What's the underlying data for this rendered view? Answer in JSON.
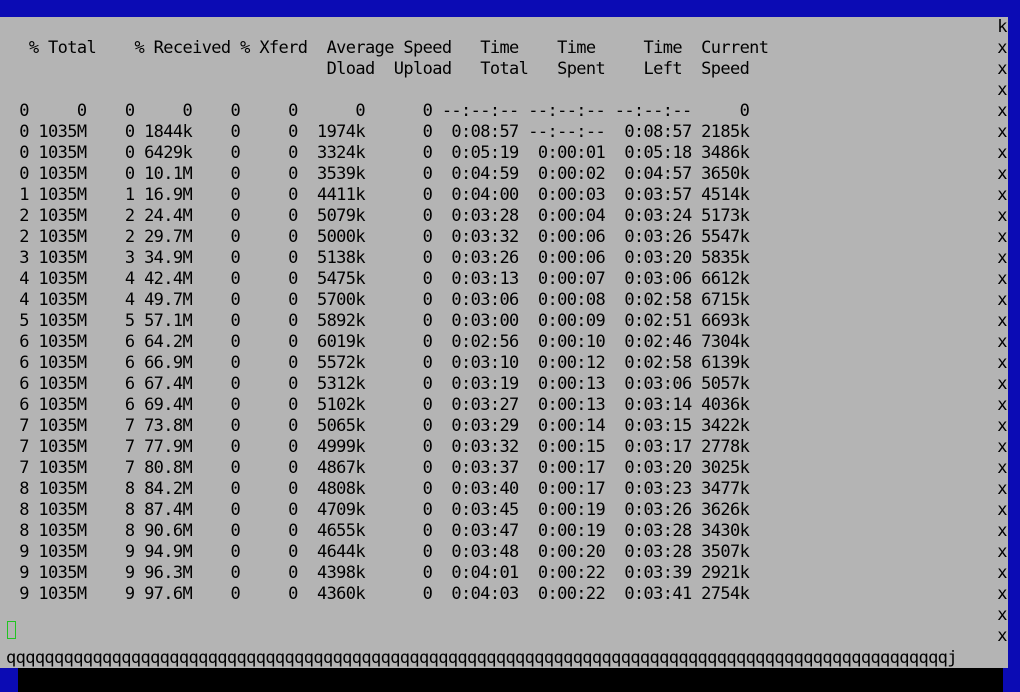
{
  "terminal": {
    "header_lines": [
      "   % Total    % Received % Xferd  Average Speed   Time    Time     Time  Current",
      "                                  Dload  Upload   Total   Spent    Left  Speed"
    ],
    "progress_lines": [
      "  0     0    0     0    0     0      0      0 --:--:-- --:--:-- --:--:--     0",
      "  0 1035M    0 1844k    0     0  1974k      0  0:08:57 --:--:--  0:08:57 2185k",
      "  0 1035M    0 6429k    0     0  3324k      0  0:05:19  0:00:01  0:05:18 3486k",
      "  0 1035M    0 10.1M    0     0  3539k      0  0:04:59  0:00:02  0:04:57 3650k",
      "  1 1035M    1 16.9M    0     0  4411k      0  0:04:00  0:00:03  0:03:57 4514k",
      "  2 1035M    2 24.4M    0     0  5079k      0  0:03:28  0:00:04  0:03:24 5173k",
      "  2 1035M    2 29.7M    0     0  5000k      0  0:03:32  0:00:06  0:03:26 5547k",
      "  3 1035M    3 34.9M    0     0  5138k      0  0:03:26  0:00:06  0:03:20 5835k",
      "  4 1035M    4 42.4M    0     0  5475k      0  0:03:13  0:00:07  0:03:06 6612k",
      "  4 1035M    4 49.7M    0     0  5700k      0  0:03:06  0:00:08  0:02:58 6715k",
      "  5 1035M    5 57.1M    0     0  5892k      0  0:03:00  0:00:09  0:02:51 6693k",
      "  6 1035M    6 64.2M    0     0  6019k      0  0:02:56  0:00:10  0:02:46 7304k",
      "  6 1035M    6 66.9M    0     0  5572k      0  0:03:10  0:00:12  0:02:58 6139k",
      "  6 1035M    6 67.4M    0     0  5312k      0  0:03:19  0:00:13  0:03:06 5057k",
      "  6 1035M    6 69.4M    0     0  5102k      0  0:03:27  0:00:13  0:03:14 4036k",
      "  7 1035M    7 73.8M    0     0  5065k      0  0:03:29  0:00:14  0:03:15 3422k",
      "  7 1035M    7 77.9M    0     0  4999k      0  0:03:32  0:00:15  0:03:17 2778k",
      "  7 1035M    7 80.8M    0     0  4867k      0  0:03:37  0:00:17  0:03:20 3025k",
      "  8 1035M    8 84.2M    0     0  4808k      0  0:03:40  0:00:17  0:03:23 3477k",
      "  8 1035M    8 87.4M    0     0  4709k      0  0:03:45  0:00:19  0:03:26 3626k",
      "  8 1035M    8 90.6M    0     0  4655k      0  0:03:47  0:00:19  0:03:28 3430k",
      "  9 1035M    9 94.9M    0     0  4644k      0  0:03:48  0:00:20  0:03:28 3507k",
      "  9 1035M    9 96.3M    0     0  4398k      0  0:04:01  0:00:22  0:03:39 2921k",
      "  9 1035M    9 97.6M    0     0  4360k      0  0:04:03  0:00:22  0:03:41 2754k"
    ],
    "right_border_chars": [
      "k",
      "x",
      "x",
      "x",
      "x",
      "x",
      "x",
      "x",
      "x",
      "x",
      "x",
      "x",
      "x",
      "x",
      "x",
      "x",
      "x",
      "x",
      "x",
      "x",
      "x",
      "x",
      "x",
      "x",
      "x",
      "x",
      "x",
      "x",
      "x",
      "x"
    ],
    "bottom_border": "qqqqqqqqqqqqqqqqqqqqqqqqqqqqqqqqqqqqqqqqqqqqqqqqqqqqqqqqqqqqqqqqqqqqqqqqqqqqqqqqqqqqqqqqqqqqqqqqqqj"
  },
  "colors": {
    "terminal_bg": "#b4b4b4",
    "text": "#000000",
    "frame_blue": "#0b0bb4",
    "cursor": "#22c422"
  }
}
